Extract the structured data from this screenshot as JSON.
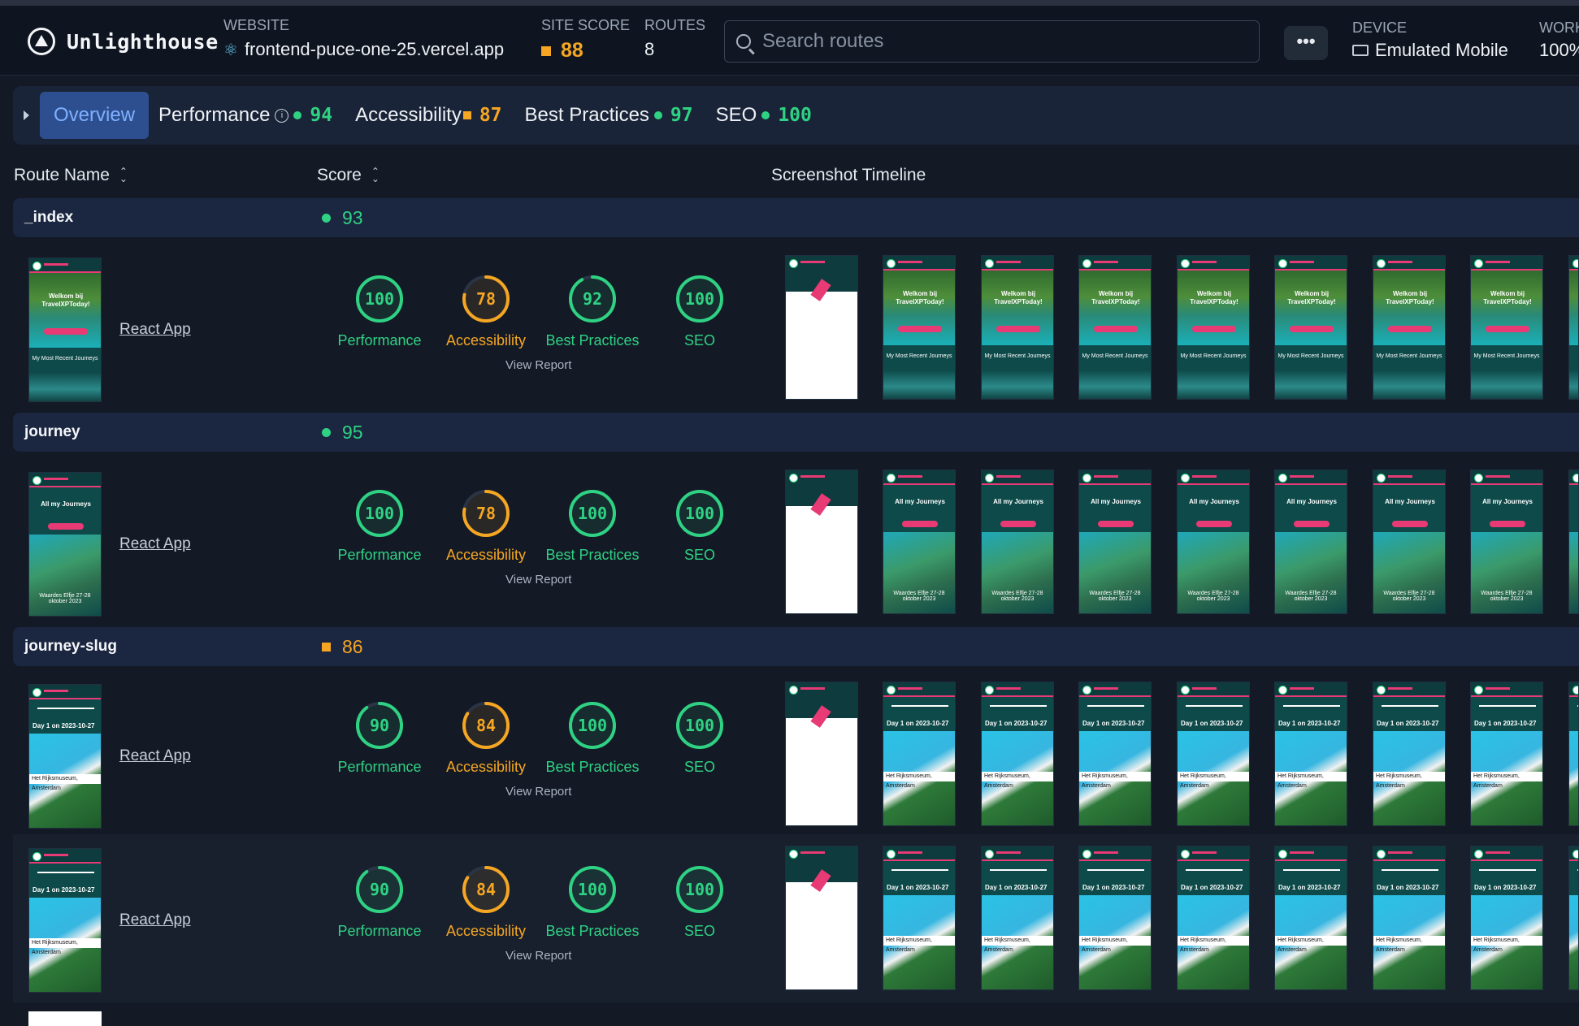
{
  "brand": {
    "name": "Unlighthouse"
  },
  "header": {
    "website_label": "WEBSITE",
    "website_value": "frontend-puce-one-25.vercel.app",
    "site_score_label": "SITE SCORE",
    "site_score_value": "88",
    "routes_label": "ROUTES",
    "routes_value": "8",
    "search_placeholder": "Search routes",
    "more_label": "•••",
    "device_label": "DEVICE",
    "device_value": "Emulated Mobile",
    "worker_label": "WORK",
    "worker_value": "100%",
    "colors": {
      "accent": "#2d4f8f",
      "good": "#2fd283",
      "average": "#f5a623"
    }
  },
  "tabs": {
    "overview": "Overview",
    "performance": {
      "label": "Performance",
      "value": "94"
    },
    "accessibility": {
      "label": "Accessibility",
      "value": "87"
    },
    "best_practices": {
      "label": "Best Practices",
      "value": "97"
    },
    "seo": {
      "label": "SEO",
      "value": "100"
    }
  },
  "columns": {
    "route_name": "Route Name",
    "score": "Score",
    "timeline": "Screenshot Timeline"
  },
  "metric_labels": [
    "Performance",
    "Accessibility",
    "Best Practices",
    "SEO"
  ],
  "view_report": "View Report",
  "groups": [
    {
      "name": "_index",
      "score": "93",
      "status": "good"
    },
    {
      "name": "journey",
      "score": "95",
      "status": "good"
    },
    {
      "name": "journey-slug",
      "score": "86",
      "status": "average"
    }
  ],
  "routes": [
    {
      "title": "React App",
      "thumb_type": "index",
      "thumb_title": "Welkom bij TravelXPToday!",
      "thumb_sub": "My Most Recent Journeys",
      "scores": [
        100,
        78,
        92,
        100
      ]
    },
    {
      "title": "React App",
      "thumb_type": "journey",
      "thumb_title": "All my Journeys",
      "thumb_sub": "Waardes Elfje 27-28 oktober 2023",
      "scores": [
        100,
        78,
        100,
        100
      ]
    },
    {
      "title": "React App",
      "thumb_type": "slug",
      "thumb_title": "Day 1 on 2023-10-27",
      "thumb_sub": "Het Rijksmuseum, Amsterdam",
      "scores": [
        90,
        84,
        100,
        100
      ]
    },
    {
      "title": "React App",
      "thumb_type": "slug",
      "thumb_title": "Day 1 on 2023-10-27",
      "thumb_sub": "Het Rijksmuseum, Amsterdam",
      "scores": [
        90,
        84,
        100,
        100
      ]
    }
  ],
  "timeline_frames": 8,
  "icons": {
    "brand": "lighthouse-logo-icon",
    "website": "react-icon",
    "search": "search-icon",
    "device": "mobile-device-icon",
    "sort": "sort-icon",
    "info": "info-icon"
  }
}
